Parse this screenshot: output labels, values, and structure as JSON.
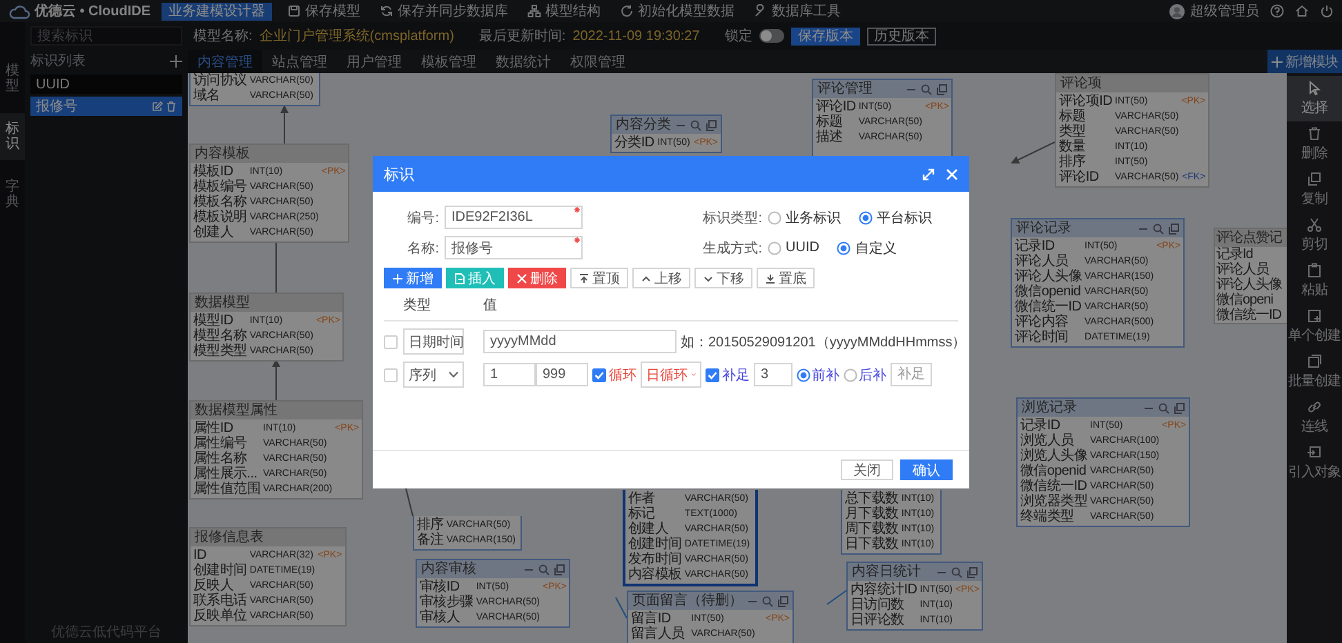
{
  "topbar": {
    "brand": "优德云 • CloudIDE",
    "badge": "业务建模设计器",
    "menu": [
      {
        "label": "保存模型"
      },
      {
        "label": "保存并同步数据库"
      },
      {
        "label": "模型结构"
      },
      {
        "label": "初始化模型数据"
      },
      {
        "label": "数据库工具"
      }
    ],
    "user": "超级管理员"
  },
  "rail": [
    {
      "label": "模型",
      "selected": false
    },
    {
      "label": "标识",
      "selected": true
    },
    {
      "label": "字典",
      "selected": false
    }
  ],
  "sidebar": {
    "search_placeholder": "搜索标识",
    "title": "标识列表",
    "items": [
      {
        "label": "UUID",
        "selected": false
      },
      {
        "label": "报修号",
        "selected": true
      }
    ],
    "footer": "优德云低代码平台"
  },
  "info": {
    "model_label": "模型名称:",
    "model_name": "企业门户管理系统(cmsplatform)",
    "updated_label": "最后更新时间:",
    "updated": "2022-11-09 19:30:27",
    "lock_label": "锁定",
    "locked": false,
    "save_version": "保存版本",
    "history": "历史版本"
  },
  "tabs": [
    {
      "label": "内容管理",
      "selected": true
    },
    {
      "label": "站点管理",
      "selected": false
    },
    {
      "label": "用户管理",
      "selected": false
    },
    {
      "label": "模板管理",
      "selected": false
    },
    {
      "label": "数据统计",
      "selected": false
    },
    {
      "label": "权限管理",
      "selected": false
    }
  ],
  "add_module": "新增模块",
  "tools": [
    {
      "label": "选择",
      "selected": true
    },
    {
      "label": "删除",
      "selected": false
    },
    {
      "label": "复制",
      "selected": false
    },
    {
      "label": "剪切",
      "selected": false
    },
    {
      "label": "粘贴",
      "selected": false
    },
    {
      "label": "单个创建",
      "selected": false
    },
    {
      "label": "批量创建",
      "selected": false
    },
    {
      "label": "连线",
      "selected": false
    },
    {
      "label": "引入对象",
      "selected": false
    }
  ],
  "canvas": {
    "tables": [
      {
        "highlighted": true,
        "selected": false,
        "columns": [
          {
            "name": "访问协议",
            "type": "VARCHAR(50)",
            "kind": "field"
          },
          {
            "name": "域名",
            "type": "VARCHAR(50)",
            "kind": "field"
          }
        ]
      },
      {
        "title": "内容模板",
        "highlighted": false,
        "selected": false,
        "columns": [
          {
            "name": "模板ID",
            "type": "INT(10)",
            "key": "<PK>",
            "kind": "primary_key"
          },
          {
            "name": "模板编号",
            "type": "VARCHAR(50)",
            "kind": "field"
          },
          {
            "name": "模板名称",
            "type": "VARCHAR(50)",
            "kind": "field"
          },
          {
            "name": "模板说明",
            "type": "VARCHAR(250)",
            "kind": "field"
          },
          {
            "name": "创建人",
            "type": "VARCHAR(50)",
            "kind": "field"
          }
        ]
      },
      {
        "title": "数据模型",
        "highlighted": false,
        "selected": false,
        "columns": [
          {
            "name": "模型ID",
            "type": "INT(10)",
            "key": "<PK>",
            "kind": "primary_key"
          },
          {
            "name": "模型名称",
            "type": "VARCHAR(50)",
            "kind": "field"
          },
          {
            "name": "模型类型",
            "type": "VARCHAR(50)",
            "kind": "field"
          }
        ]
      },
      {
        "title": "数据模型属性",
        "highlighted": false,
        "selected": false,
        "columns": [
          {
            "name": "属性ID",
            "type": "INT(10)",
            "key": "<PK>",
            "kind": "primary_key"
          },
          {
            "name": "属性编号",
            "type": "VARCHAR(50)",
            "kind": "field"
          },
          {
            "name": "属性名称",
            "type": "VARCHAR(50)",
            "kind": "field"
          },
          {
            "name": "属性展示...",
            "type": "VARCHAR(50)",
            "kind": "field"
          },
          {
            "name": "属性值范围",
            "type": "VARCHAR(200)",
            "kind": "field"
          }
        ]
      },
      {
        "title": "报修信息表",
        "highlighted": false,
        "selected": false,
        "columns": [
          {
            "name": "ID",
            "type": "VARCHAR(32)",
            "key": "<PK>",
            "kind": "primary_key"
          },
          {
            "name": "创建时间",
            "type": "DATETIME(19)",
            "kind": "field"
          },
          {
            "name": "反映人",
            "type": "VARCHAR(50)",
            "kind": "field"
          },
          {
            "name": "联系电话",
            "type": "VARCHAR(50)",
            "kind": "field"
          },
          {
            "name": "反映单位",
            "type": "VARCHAR(50)",
            "kind": "field"
          }
        ]
      },
      {
        "title": "内容分类",
        "highlighted": true,
        "selected": false,
        "columns": [
          {
            "name": "分类ID",
            "type": "INT(50)",
            "key": "<PK>",
            "kind": "primary_key"
          }
        ]
      },
      {
        "title": "评论管理",
        "highlighted": true,
        "selected": false,
        "columns": [
          {
            "name": "评论ID",
            "type": "INT(50)",
            "key": "<PK>",
            "kind": "primary_key"
          },
          {
            "name": "标题",
            "type": "VARCHAR(50)",
            "kind": "field"
          },
          {
            "name": "描述",
            "type": "VARCHAR(50)",
            "kind": "field"
          }
        ]
      },
      {
        "title": "评论项",
        "highlighted": false,
        "selected": false,
        "columns": [
          {
            "name": "评论项ID",
            "type": "INT(50)",
            "key": "<PK>",
            "kind": "primary_key"
          },
          {
            "name": "标题",
            "type": "VARCHAR(50)",
            "kind": "field"
          },
          {
            "name": "类型",
            "type": "VARCHAR(50)",
            "kind": "field"
          },
          {
            "name": "数量",
            "type": "INT(10)",
            "kind": "field"
          },
          {
            "name": "排序",
            "type": "INT(50)",
            "kind": "field"
          },
          {
            "name": "评论ID",
            "type": "VARCHAR(50)",
            "key": "<FK>",
            "kind": "foreign_key"
          }
        ]
      },
      {
        "title": "评论记录",
        "highlighted": true,
        "selected": false,
        "columns": [
          {
            "name": "记录ID",
            "type": "INT(50)",
            "key": "<PK>",
            "kind": "primary_key"
          },
          {
            "name": "评论人员",
            "type": "VARCHAR(50)",
            "kind": "field"
          },
          {
            "name": "评论人头像",
            "type": "VARCHAR(150)",
            "kind": "field"
          },
          {
            "name": "微信openid",
            "type": "VARCHAR(50)",
            "kind": "field"
          },
          {
            "name": "微信统一ID",
            "type": "VARCHAR(50)",
            "kind": "field"
          },
          {
            "name": "评论内容",
            "type": "VARCHAR(500)",
            "kind": "field"
          },
          {
            "name": "评论时间",
            "type": "DATETIME(19)",
            "kind": "field"
          }
        ]
      },
      {
        "title": "评论点赞记",
        "highlighted": false,
        "selected": false,
        "columns": [
          {
            "name": "记录Id",
            "kind": "field"
          },
          {
            "name": "评论人员",
            "kind": "field"
          },
          {
            "name": "评论人头像",
            "kind": "field"
          },
          {
            "name": "微信openi",
            "kind": "field"
          },
          {
            "name": "微信统一ID",
            "kind": "field"
          }
        ]
      },
      {
        "title": "浏览记录",
        "highlighted": true,
        "selected": false,
        "columns": [
          {
            "name": "记录ID",
            "type": "INT(50)",
            "key": "<PK>",
            "kind": "primary_key"
          },
          {
            "name": "浏览人员",
            "type": "VARCHAR(100)",
            "kind": "field"
          },
          {
            "name": "浏览人头像",
            "type": "VARCHAR(150)",
            "kind": "field"
          },
          {
            "name": "微信openid",
            "type": "VARCHAR(50)",
            "kind": "field"
          },
          {
            "name": "微信统一ID",
            "type": "VARCHAR(50)",
            "kind": "field"
          },
          {
            "name": "浏览器类型",
            "type": "VARCHAR(50)",
            "kind": "field"
          },
          {
            "name": "终端类型",
            "type": "VARCHAR(50)",
            "kind": "field"
          }
        ]
      },
      {
        "highlighted": true,
        "selected": false,
        "columns": [
          {
            "name": "排序",
            "type": "VARCHAR(50)",
            "kind": "field"
          },
          {
            "name": "备注",
            "type": "VARCHAR(150)",
            "kind": "field"
          }
        ]
      },
      {
        "highlighted": true,
        "selected": true,
        "columns": [
          {
            "name": "作者",
            "type": "VARCHAR(50)",
            "kind": "field"
          },
          {
            "name": "标记",
            "type": "TEXT(1000)",
            "kind": "field"
          },
          {
            "name": "创建人",
            "type": "VARCHAR(50)",
            "kind": "field"
          },
          {
            "name": "创建时间",
            "type": "DATETIME(19)",
            "kind": "field"
          },
          {
            "name": "发布时间",
            "type": "VARCHAR(50)",
            "kind": "field"
          },
          {
            "name": "内容模板",
            "type": "VARCHAR(50)",
            "kind": "field"
          }
        ]
      },
      {
        "title": "内容审核",
        "highlighted": true,
        "selected": false,
        "columns": [
          {
            "name": "审核ID",
            "type": "INT(50)",
            "key": "<PK>",
            "kind": "primary_key"
          },
          {
            "name": "审核步骤",
            "type": "VARCHAR(50)",
            "kind": "field"
          },
          {
            "name": "审核人",
            "type": "VARCHAR(50)",
            "kind": "field"
          }
        ]
      },
      {
        "title": "页面留言（待删）",
        "highlighted": true,
        "selected": false,
        "columns": [
          {
            "name": "留言ID",
            "type": "INT(50)",
            "key": "<PK>",
            "kind": "primary_key"
          },
          {
            "name": "留言人员",
            "type": "VARCHAR(50)",
            "kind": "field"
          }
        ]
      },
      {
        "highlighted": true,
        "selected": false,
        "columns": [
          {
            "name": "总下载数",
            "type": "INT(10)",
            "kind": "field"
          },
          {
            "name": "月下载数",
            "type": "INT(10)",
            "kind": "field"
          },
          {
            "name": "周下载数",
            "type": "INT(10)",
            "kind": "field"
          },
          {
            "name": "日下载数",
            "type": "INT(10)",
            "kind": "field"
          }
        ]
      },
      {
        "title": "内容日统计",
        "highlighted": true,
        "selected": false,
        "columns": [
          {
            "name": "内容统计ID",
            "type": "INT(50)",
            "key": "<PK>",
            "kind": "primary_key"
          },
          {
            "name": "日访问数",
            "type": "INT(10)",
            "kind": "field"
          },
          {
            "name": "日评论数",
            "type": "INT(10)",
            "kind": "field"
          }
        ]
      }
    ]
  },
  "dialog": {
    "title": "标识",
    "fields": [
      {
        "label": "编号:",
        "value": "IDE92F2I36L",
        "required": true
      },
      {
        "label": "名称:",
        "value": "报修号",
        "required": true
      }
    ],
    "options": [
      {
        "label": "标识类型:",
        "choices": [
          {
            "label": "业务标识",
            "selected": false
          },
          {
            "label": "平台标识",
            "selected": true
          }
        ]
      },
      {
        "label": "生成方式:",
        "choices": [
          {
            "label": "UUID",
            "selected": false
          },
          {
            "label": "自定义",
            "selected": true
          }
        ]
      }
    ],
    "actions": [
      {
        "label": "新增",
        "kind": "primary"
      },
      {
        "label": "插入",
        "kind": "insert"
      },
      {
        "label": "删除",
        "kind": "danger"
      },
      {
        "label": "置顶",
        "kind": "plain"
      },
      {
        "label": "上移",
        "kind": "plain"
      },
      {
        "label": "下移",
        "kind": "plain"
      },
      {
        "label": "置底",
        "kind": "plain"
      }
    ],
    "columns": [
      "类型",
      "值"
    ],
    "rows": [
      {
        "kind": "datetime",
        "checked": false,
        "type": "日期时间",
        "format": "yyyyMMdd",
        "hint": "如：20150529091201（yyyyMMddHHmmss）"
      },
      {
        "kind": "sequence",
        "checked": false,
        "type": "序列",
        "start": "1",
        "end": "999",
        "cycle": {
          "label": "循环",
          "checked": true,
          "period": "日循环"
        },
        "pad": {
          "label": "补足",
          "checked": true,
          "length": "3",
          "sides": [
            {
              "label": "前补",
              "selected": true
            },
            {
              "label": "后补",
              "selected": false
            }
          ],
          "placeholder": "补足"
        }
      }
    ],
    "buttons": [
      {
        "label": "关闭",
        "kind": "default"
      },
      {
        "label": "确认",
        "kind": "primary"
      }
    ]
  }
}
